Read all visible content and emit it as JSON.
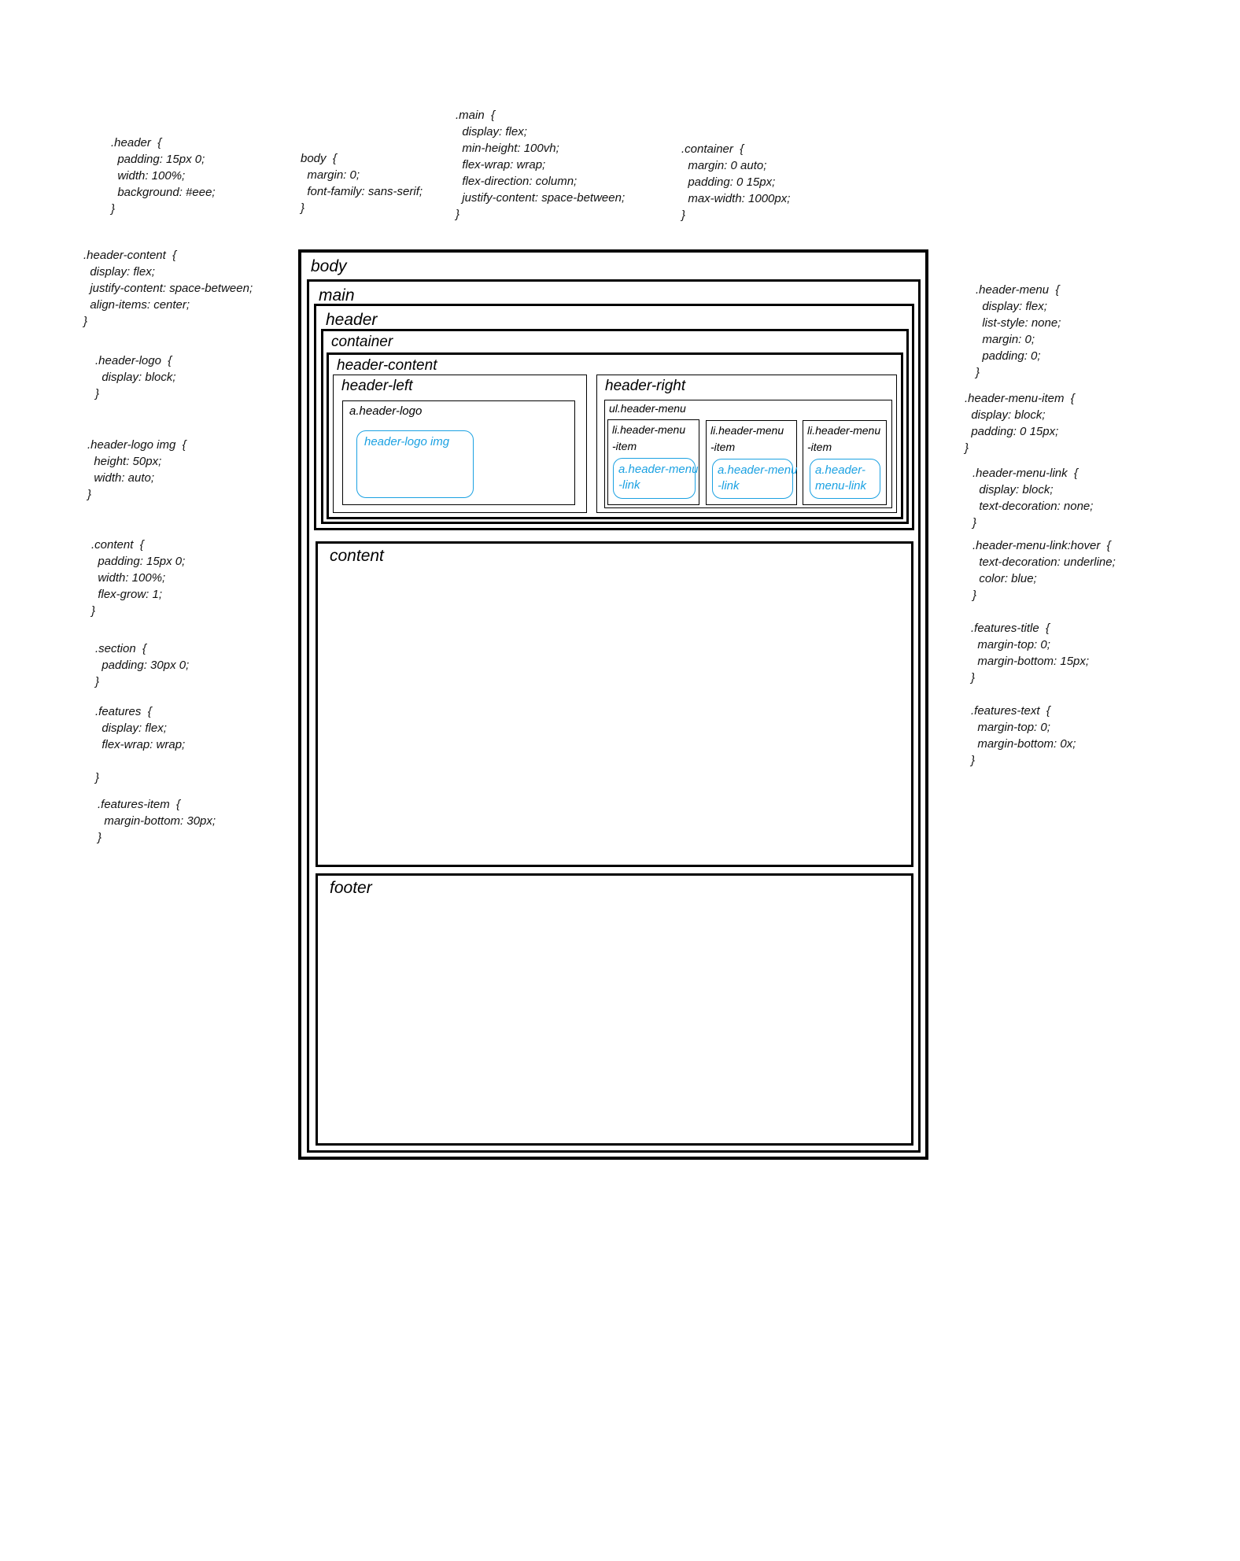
{
  "notes": {
    "header": ".header  {\n  padding: 15px 0;\n  width: 100%;\n  background: #eee;\n}",
    "body": "body  {\n  margin: 0;\n  font-family: sans-serif;\n}",
    "main": ".main  {\n  display: flex;\n  min-height: 100vh;\n  flex-wrap: wrap;\n  flex-direction: column;\n  justify-content: space-between;\n}",
    "container": ".container  {\n  margin: 0 auto;\n  padding: 0 15px;\n  max-width: 1000px;\n}",
    "header_content": ".header-content  {\n  display: flex;\n  justify-content: space-between;\n  align-items: center;\n}",
    "header_logo": ".header-logo  {\n  display: block;\n}",
    "header_logo_img": ".header-logo img  {\n  height: 50px;\n  width: auto;\n}",
    "content": ".content  {\n  padding: 15px 0;\n  width: 100%;\n  flex-grow: 1;\n}",
    "section": ".section  {\n  padding: 30px 0;\n}",
    "features": ".features  {\n  display: flex;\n  flex-wrap: wrap;\n\n}",
    "features_item": ".features-item  {\n  margin-bottom: 30px;\n}",
    "header_menu": ".header-menu  {\n  display: flex;\n  list-style: none;\n  margin: 0;\n  padding: 0;\n}",
    "header_menu_item": ".header-menu-item  {\n  display: block;\n  padding: 0 15px;\n}",
    "header_menu_link": ".header-menu-link  {\n  display: block;\n  text-decoration: none;\n}",
    "header_menu_link_hover": ".header-menu-link:hover  {\n  text-decoration: underline;\n  color: blue;\n}",
    "features_title": ".features-title  {\n  margin-top: 0;\n  margin-bottom: 15px;\n}",
    "features_text": ".features-text  {\n  margin-top: 0;\n  margin-bottom: 0x;\n}"
  },
  "diagram": {
    "body": "body",
    "main": "main",
    "header": "header",
    "container": "container",
    "header_content": "header-content",
    "header_left": "header-left",
    "header_logo": "a.header-logo",
    "header_logo_img": "header-logo img",
    "header_right": "header-right",
    "header_menu": "ul.header-menu",
    "menu_items": [
      {
        "item": "li.header-menu\n-item",
        "link": "a.header-menu\n-link"
      },
      {
        "item": "li.header-menu\n-item",
        "link": "a.header-menu\n-link"
      },
      {
        "item": "li.header-menu\n-item",
        "link": "a.header-\nmenu-link"
      }
    ],
    "content": "content",
    "footer": "footer"
  },
  "colors": {
    "outline": "#000000",
    "highlight": "#1ba1e2"
  }
}
